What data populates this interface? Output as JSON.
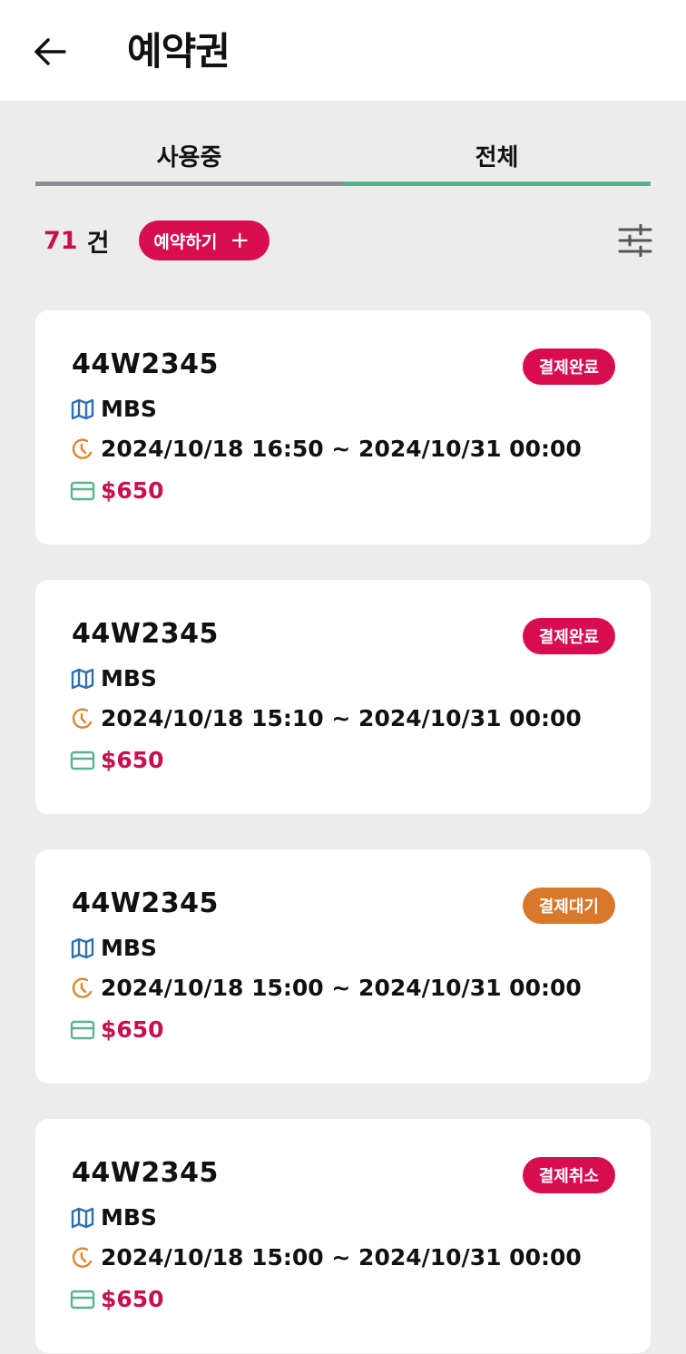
{
  "header": {
    "title": "예약권"
  },
  "tabs": [
    {
      "label": "사용중",
      "active": false
    },
    {
      "label": "전체",
      "active": true
    }
  ],
  "summary": {
    "count": "71",
    "unit": "건",
    "reserve_label": "예약하기",
    "reserve_icon": "+"
  },
  "colors": {
    "accent": "#d80d4f",
    "pending": "#d9782a",
    "tab_active": "#5bb38e",
    "tab_inactive": "#8e8c93",
    "map_icon": "#2f6fb0",
    "clock_icon": "#d9862f",
    "card_icon": "#5bb38e"
  },
  "reservations": [
    {
      "plate": "44W2345",
      "status": "결제완료",
      "location": "MBS",
      "period": "2024/10/18 16:50 ~ 2024/10/31 00:00",
      "price": "$650"
    },
    {
      "plate": "44W2345",
      "status": "결제완료",
      "location": "MBS",
      "period": "2024/10/18 15:10 ~ 2024/10/31 00:00",
      "price": "$650"
    },
    {
      "plate": "44W2345",
      "status": "결제대기",
      "location": "MBS",
      "period": "2024/10/18 15:00 ~ 2024/10/31 00:00",
      "price": "$650"
    },
    {
      "plate": "44W2345",
      "status": "결제취소",
      "location": "MBS",
      "period": "2024/10/18 15:00 ~ 2024/10/31 00:00",
      "price": "$650"
    }
  ]
}
